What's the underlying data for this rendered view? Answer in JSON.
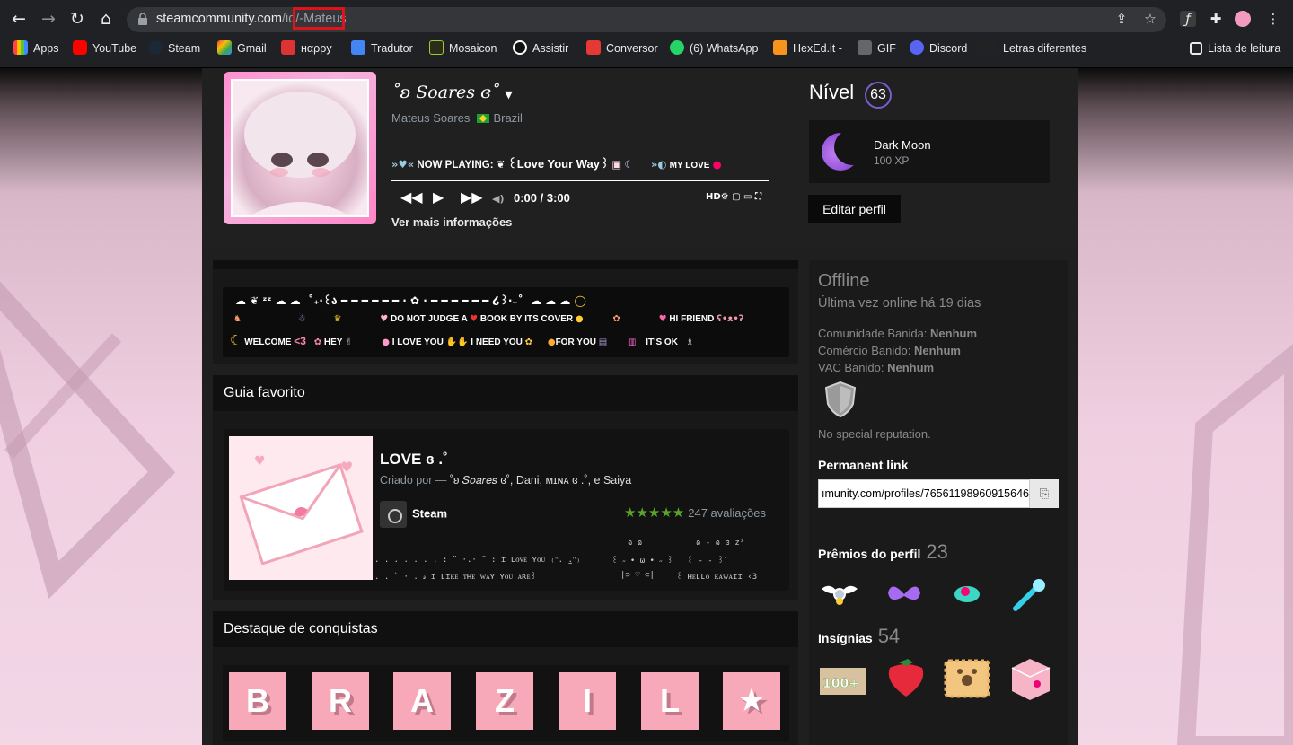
{
  "browser": {
    "url_domain": "steamcommunity.com",
    "url_path": "/id/",
    "url_highlight": "-Mateus",
    "bookmarks": [
      {
        "label": "Apps",
        "icon": "apps-grid-icon"
      },
      {
        "label": "YouTube",
        "icon": "youtube-icon"
      },
      {
        "label": "Steam",
        "icon": "steam-icon"
      },
      {
        "label": "Gmail",
        "icon": "gmail-icon"
      },
      {
        "label": "нαρρу",
        "icon": "happy-icon"
      },
      {
        "label": "Tradutor",
        "icon": "translate-icon"
      },
      {
        "label": "Mosaicon",
        "icon": "mosaicon-icon"
      },
      {
        "label": "Assistir",
        "icon": "assistir-icon"
      },
      {
        "label": "Conversor",
        "icon": "download-icon"
      },
      {
        "label": "(6) WhatsApp",
        "icon": "whatsapp-icon"
      },
      {
        "label": "HexEd.it -",
        "icon": "hexed-icon"
      },
      {
        "label": "GIF",
        "icon": "gif-icon"
      },
      {
        "label": "Discord",
        "icon": "discord-icon"
      },
      {
        "label": "Letras diferentes",
        "icon": "letras-icon"
      }
    ],
    "reading_list": "Lista de leitura"
  },
  "profile": {
    "persona": "˚ʚ 𝑆𝑜𝑎𝑟𝑒𝑠 ɞ˚",
    "real_name": "Mateus Soares",
    "country": "Brazil",
    "now_playing_label": "NOW PLAYING:",
    "song": "꒰Love Your Way꒱",
    "my_love": "MY LOVE",
    "time": "0:00 / 3:00",
    "hd": "HD",
    "more_info": "Ver mais informações",
    "level_label": "Nível",
    "level": "63",
    "fav_badge_name": "Dark Moon",
    "fav_badge_xp": "100 XP",
    "edit_button": "Editar perfil"
  },
  "showcase_art": {
    "line1": "˚₊‧꒰ა ━ ━ ━ ━ ━ ━ · ✿ · ━ ━ ━ ━ ━ ━ ໒꒱‧₊˚",
    "line2_a": "DO NOT JUDGE A",
    "line2_b": "BOOK BY ITS COVER",
    "line2_c": "HI FRIEND",
    "line3_a": "WELCOME",
    "line3_heart": "<3",
    "line3_b": "HEY",
    "line3_c": "I LOVE YOU",
    "line3_d": "I NEED YOU",
    "line3_e": "FOR YOU",
    "line3_f": "IT'S OK"
  },
  "guide": {
    "section_title": "Guia favorito",
    "title": "LOVE ɞ .˚",
    "by_prefix": "Criado por —",
    "authors": "˚ʚ 𝑆𝑜𝑎𝑟𝑒𝑠 ɞ˚, Dani, ᴍɪɴᴀ ɞ .˚, e Saiya",
    "app": "Steam",
    "stars": "★★★★★",
    "reviews": "247 avaliações",
    "desc1": ". . . . . . . : ¨ ·.· ¨ :  ɪ ʟᴏᴠᴇ ʏᴏᴜ ₍ᐢ. ̫.ᐢ₎",
    "desc2": ". .            ` · .  𝓈 ɪ ʟɪᴋᴇ ᴛʜᴇ ᴡᴀʏ ʏᴏᴜ ᴀʀᴇ꒱",
    "desc3": "ɷ ɷ",
    "desc4": "꒰ ˶ • ω • ˶ ꒱",
    "desc5": "|⊃ ♡ ⊂|",
    "desc6": "ɷ - ɷ  ɞ  zᶻ",
    "desc7": "꒰ - - ꒱ᐝ",
    "desc8": "꒰ ʜᴇʟʟᴏ  ᴋᴀᴡᴀɪɪ ‹3"
  },
  "achievements": {
    "section_title": "Destaque de conquistas",
    "tiles": [
      "B",
      "R",
      "A",
      "Z",
      "I",
      "L",
      "★"
    ]
  },
  "sidebar": {
    "status": "Offline",
    "last_online": "Última vez online há 19 dias",
    "community_ban_label": "Comunidade Banida:",
    "community_ban": "Nenhum",
    "trade_ban_label": "Comércio Banido:",
    "trade_ban": "Nenhum",
    "vac_label": "VAC Banido:",
    "vac": "Nenhum",
    "reputation": "No special reputation.",
    "permanent_link_label": "Permanent link",
    "permanent_link": "ımunity.com/profiles/76561198960915646",
    "awards_label": "Prêmios do perfil",
    "awards_count": "23",
    "badges_label": "Insígnias",
    "badges_count": "54"
  },
  "colors": {
    "accent_level": "#7b5ecd",
    "url_highlight_border": "#e0131b",
    "tile_pink": "#f7a9ba",
    "stars_green": "#5ba32b"
  }
}
